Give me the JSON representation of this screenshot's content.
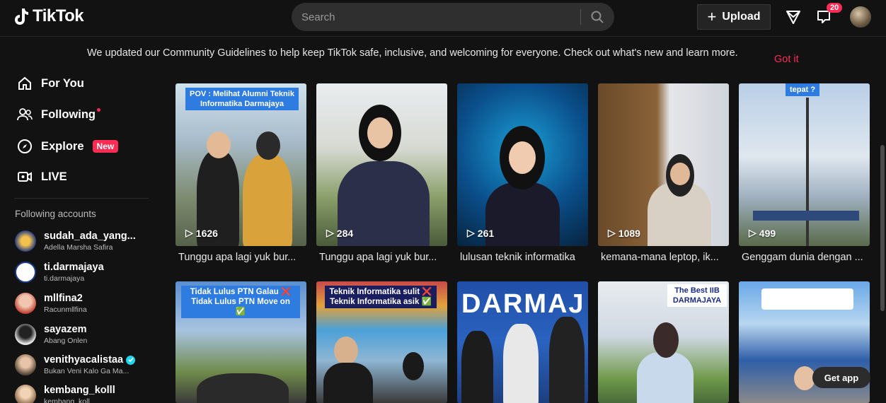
{
  "header": {
    "logo_text": "TikTok",
    "search_placeholder": "Search",
    "upload_label": "Upload",
    "inbox_badge": "20"
  },
  "notice": {
    "text": "We updated our Community Guidelines to help keep TikTok safe, inclusive, and welcoming for everyone. Check out what's new and learn more.",
    "dismiss_label": "Got it"
  },
  "sidebar": {
    "nav": [
      {
        "label": "For You",
        "icon": "home-icon"
      },
      {
        "label": "Following",
        "icon": "following-icon"
      },
      {
        "label": "Explore",
        "icon": "compass-icon",
        "tag": "New"
      },
      {
        "label": "LIVE",
        "icon": "live-icon"
      }
    ],
    "accounts_title": "Following accounts",
    "accounts": [
      {
        "name": "sudah_ada_yang...",
        "sub": "Adella Marsha Safira"
      },
      {
        "name": "ti.darmajaya",
        "sub": "ti.darmajaya"
      },
      {
        "name": "mllfina2",
        "sub": "Racunmllfina"
      },
      {
        "name": "sayazem",
        "sub": "Abang Onlen"
      },
      {
        "name": "venithyacalistaa",
        "sub": "Bukan Veni Kalo Ga Ma...",
        "verified": true
      },
      {
        "name": "kembang_kolll",
        "sub": "kembang_koll"
      }
    ]
  },
  "videos": [
    {
      "views": "1626",
      "caption": "Tunggu apa lagi yuk bur...",
      "overlay": "POV : Melihat Alumni Teknik Informatika Darmajaya"
    },
    {
      "views": "284",
      "caption": "Tunggu apa lagi yuk bur..."
    },
    {
      "views": "261",
      "caption": "lulusan teknik informatika"
    },
    {
      "views": "1089",
      "caption": "kemana-mana leptop, ik..."
    },
    {
      "views": "499",
      "caption": "Genggam dunia dengan ...",
      "overlay": "tepat ?"
    },
    {
      "overlay": "Tidak Lulus PTN Galau ❌ Tidak Lulus PTN Move on ✅"
    },
    {
      "overlay": "Teknik Informatika sulit ❌ Teknik Informatika asik ✅"
    },
    {
      "overlay": "DARMAJ"
    },
    {
      "overlay": "The Best IIB DARMAJAYA"
    },
    {
      "overlay": ""
    }
  ],
  "get_app_label": "Get app",
  "colors": {
    "accent": "#fe2c55",
    "background": "#121212"
  }
}
